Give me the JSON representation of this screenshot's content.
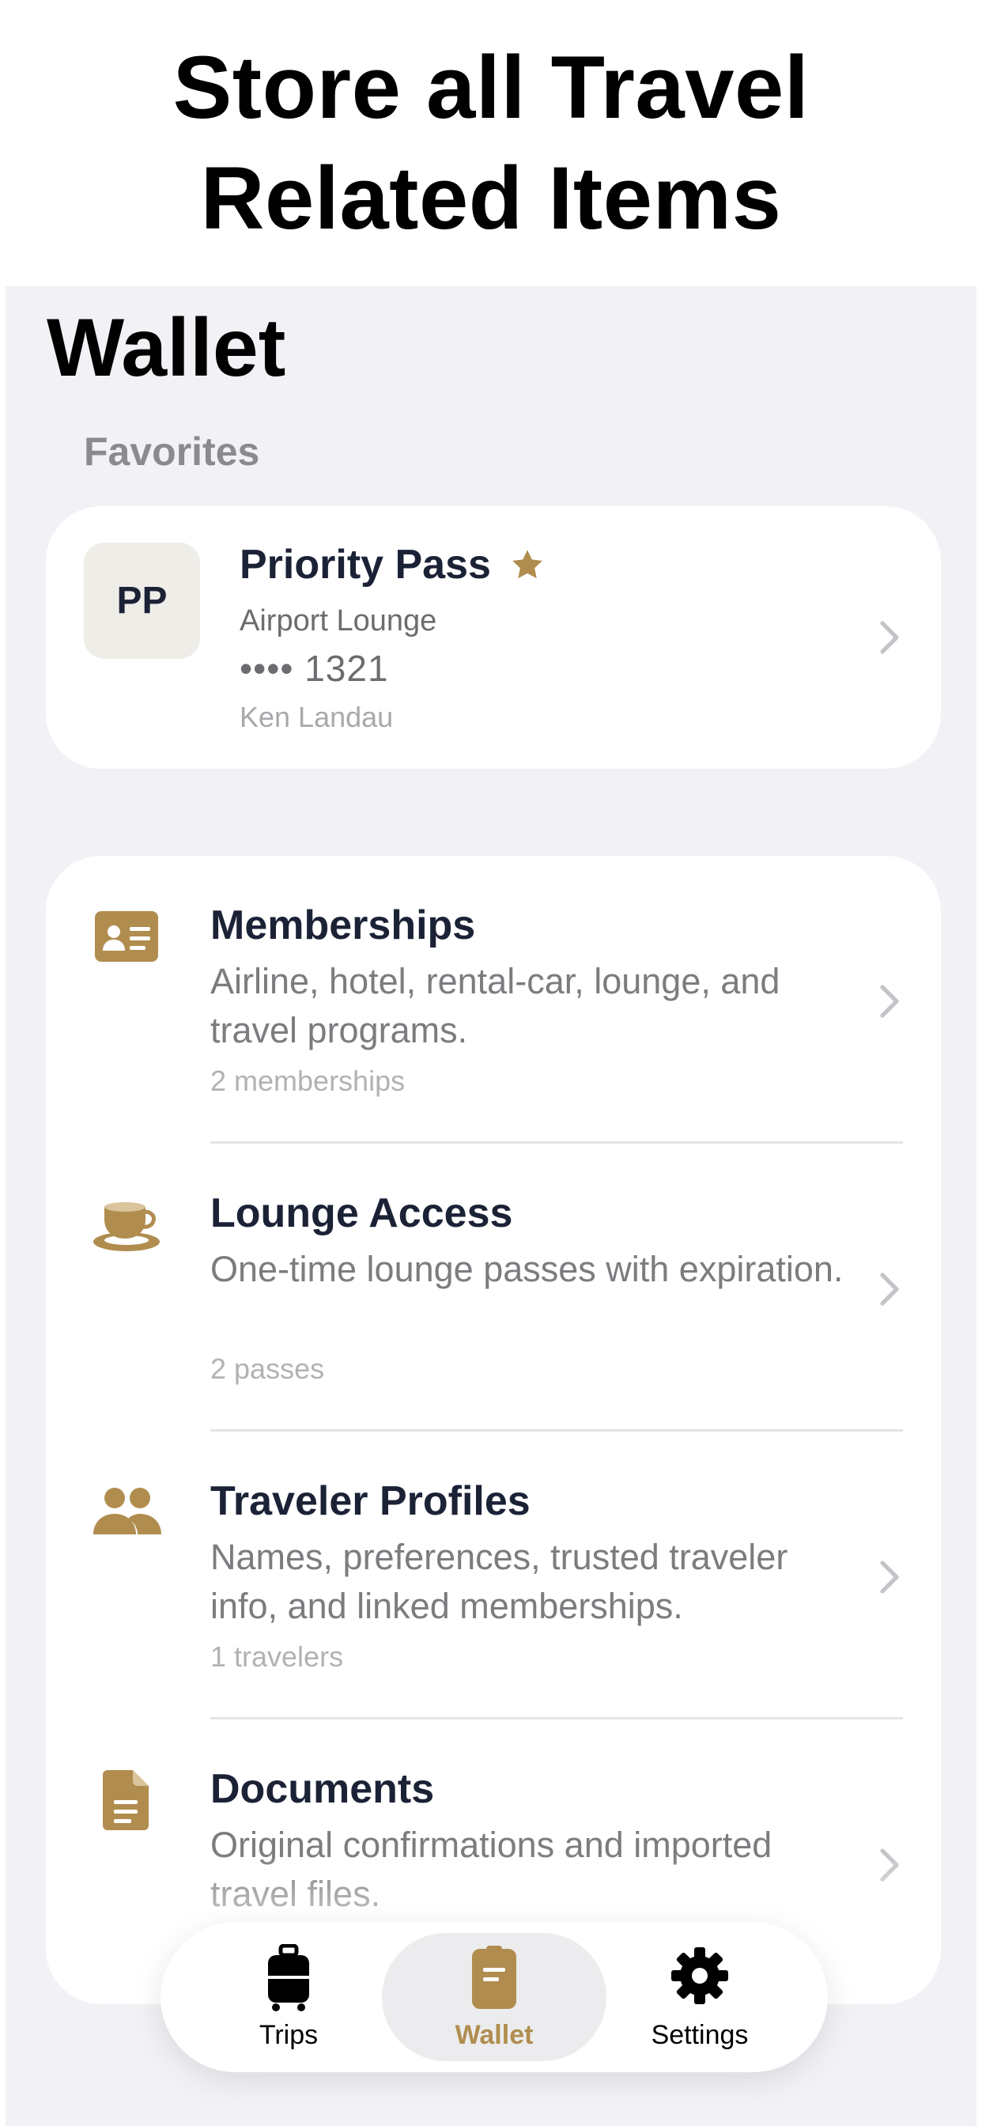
{
  "hero": {
    "line1": "Store all Travel",
    "line2": "Related Items"
  },
  "page": {
    "title": "Wallet"
  },
  "favorites": {
    "section_label": "Favorites",
    "card": {
      "badge": "PP",
      "title": "Priority Pass",
      "subtitle": "Airport Lounge",
      "number": "•••• 1321",
      "owner": "Ken Landau",
      "favorite_icon": "star-icon"
    }
  },
  "categories": [
    {
      "icon": "id-card-icon",
      "title": "Memberships",
      "description": "Airline, hotel, rental-car, lounge, and travel programs.",
      "count": "2 memberships"
    },
    {
      "icon": "coffee-cup-icon",
      "title": "Lounge Access",
      "description": "One-time lounge passes with expiration.",
      "count": "2 passes"
    },
    {
      "icon": "people-icon",
      "title": "Traveler Profiles",
      "description": "Names, preferences, trusted traveler info, and linked memberships.",
      "count": "1 travelers"
    },
    {
      "icon": "document-icon",
      "title": "Documents",
      "description": "Original confirmations and imported travel files.",
      "count": ""
    }
  ],
  "tabbar": {
    "tabs": [
      {
        "label": "Trips",
        "icon": "suitcase-icon",
        "active": false
      },
      {
        "label": "Wallet",
        "icon": "wallet-icon",
        "active": true
      },
      {
        "label": "Settings",
        "icon": "gear-icon",
        "active": false
      }
    ]
  },
  "colors": {
    "accent": "#b08d4f",
    "background": "#f2f2f6",
    "title": "#1c2236"
  }
}
